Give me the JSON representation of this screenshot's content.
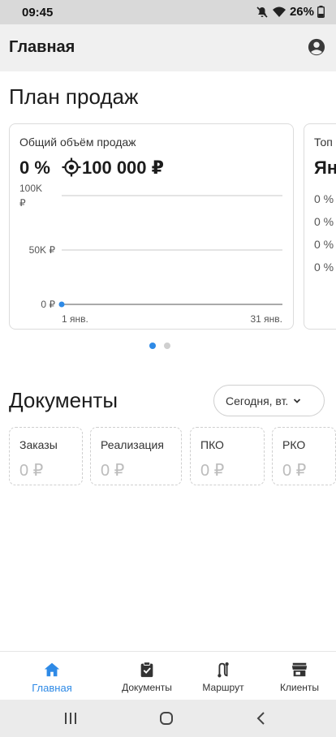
{
  "status_bar": {
    "time": "09:45",
    "battery": "26%",
    "icons": [
      "mute-icon",
      "wifi-icon",
      "battery-icon"
    ]
  },
  "app_bar": {
    "title": "Главная",
    "account_icon": "account-circle-icon"
  },
  "sales_plan": {
    "title": "План продаж",
    "cards": [
      {
        "label": "Общий объём продаж",
        "percent": "0 %",
        "target": "100 000 ₽",
        "chart_y_labels": [
          "100K ₽",
          "50K ₽",
          "0 ₽"
        ],
        "chart_x_labels": [
          "1 янв.",
          "31 янв."
        ]
      },
      {
        "label": "Топ",
        "name": "Ян",
        "values": [
          "0 %",
          "0 %",
          "0 %",
          "0 %"
        ]
      }
    ],
    "pager": {
      "count": 2,
      "active": 0
    }
  },
  "chart_data": {
    "type": "line",
    "title": "Общий объём продаж",
    "x": [
      "1 янв."
    ],
    "series": [
      {
        "values": [
          0
        ]
      }
    ],
    "x_tick_labels": [
      "1 янв.",
      "31 янв."
    ],
    "y_tick_labels": [
      "0 ₽",
      "50K ₽",
      "100K ₽"
    ],
    "ylim": [
      0,
      100000
    ],
    "grid": true,
    "colors": {
      "point": "#2e8ae6",
      "grid": "#c8c8c8",
      "axis": "#555555"
    }
  },
  "documents": {
    "title": "Документы",
    "period_select": "Сегодня, вт.",
    "cards": [
      {
        "title": "Заказы",
        "value": "0 ₽"
      },
      {
        "title": "Реализация",
        "value": "0 ₽"
      },
      {
        "title": "ПКО",
        "value": "0 ₽"
      },
      {
        "title": "РКО",
        "value": "0 ₽"
      }
    ]
  },
  "bottom_nav": {
    "items": [
      {
        "label": "Главная",
        "icon": "home-icon",
        "active": true
      },
      {
        "label": "Документы",
        "icon": "clipboard-check-icon",
        "active": false
      },
      {
        "label": "Маршрут",
        "icon": "route-icon",
        "active": false
      },
      {
        "label": "Клиенты",
        "icon": "store-icon",
        "active": false
      }
    ]
  },
  "colors": {
    "accent": "#2e8ae6",
    "app_bar": "#f0f0f0",
    "status_bar": "#d9d9d9",
    "text": "#1c1c1c"
  }
}
